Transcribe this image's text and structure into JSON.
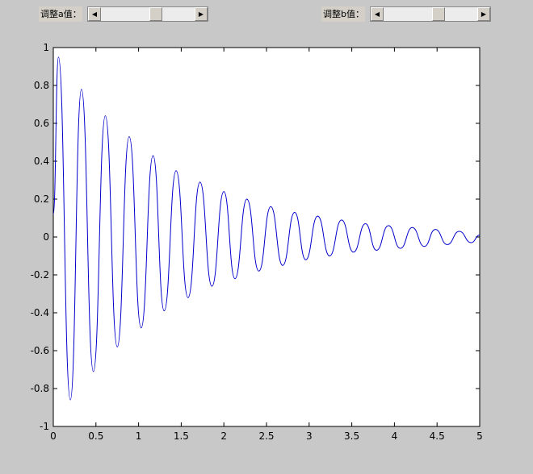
{
  "controls": {
    "a": {
      "label": "调整a值：",
      "value": 0.6
    },
    "b": {
      "label": "调整b值：",
      "value": 0.6
    }
  },
  "chart_data": {
    "type": "line",
    "title": "",
    "xlabel": "",
    "ylabel": "",
    "xlim": [
      0,
      5
    ],
    "ylim": [
      -1,
      1
    ],
    "xticks": [
      "0",
      "0.5",
      "1",
      "1.5",
      "2",
      "2.5",
      "3",
      "3.5",
      "4",
      "4.5",
      "5"
    ],
    "yticks": [
      "-1",
      "-0.8",
      "-0.6",
      "-0.4",
      "-0.2",
      "0",
      "0.2",
      "0.4",
      "0.6",
      "0.8",
      "1"
    ],
    "grid": false,
    "series": [
      {
        "color": "#0000cc",
        "x": [
          0,
          0.06,
          0.2,
          0.33,
          0.47,
          0.61,
          0.75,
          0.89,
          1.03,
          1.17,
          1.3,
          1.44,
          1.58,
          1.72,
          1.86,
          2.0,
          2.13,
          2.27,
          2.41,
          2.55,
          2.69,
          2.83,
          2.96,
          3.1,
          3.24,
          3.38,
          3.52,
          3.66,
          3.79,
          3.93,
          4.07,
          4.21,
          4.35,
          4.48,
          4.62,
          4.76,
          4.9,
          5.0
        ],
        "y": [
          0.12,
          0.95,
          -0.86,
          0.78,
          -0.71,
          0.64,
          -0.58,
          0.53,
          -0.48,
          0.43,
          -0.39,
          0.35,
          -0.32,
          0.29,
          -0.26,
          0.24,
          -0.22,
          0.2,
          -0.18,
          0.16,
          -0.15,
          0.13,
          -0.12,
          0.11,
          -0.1,
          0.09,
          -0.08,
          0.07,
          -0.07,
          0.06,
          -0.06,
          0.05,
          -0.05,
          0.04,
          -0.04,
          0.03,
          -0.03,
          0.01
        ]
      }
    ]
  }
}
